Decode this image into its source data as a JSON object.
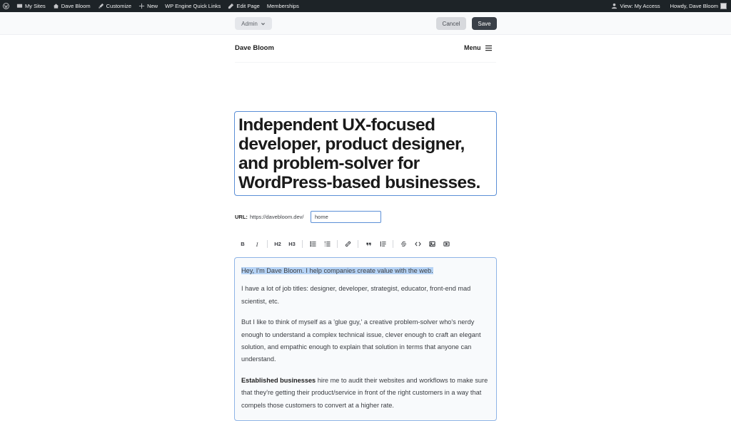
{
  "adminbar": {
    "left": [
      {
        "label": "",
        "icon": "wordpress-logo-icon"
      },
      {
        "label": "My Sites",
        "icon": "my-sites-icon"
      },
      {
        "label": "Dave Bloom",
        "icon": "home-dashboard-icon"
      },
      {
        "label": "Customize",
        "icon": "brush-icon"
      },
      {
        "label": "New",
        "icon": "plus-icon"
      },
      {
        "label": "WP Engine Quick Links",
        "icon": ""
      },
      {
        "label": "Edit Page",
        "icon": "pencil-icon"
      },
      {
        "label": "Memberships",
        "icon": ""
      }
    ],
    "view_access": "View: My Access",
    "howdy": "Howdy, Dave Bloom"
  },
  "toolbar": {
    "admin_label": "Admin",
    "cancel_label": "Cancel",
    "save_label": "Save"
  },
  "site": {
    "title": "Dave Bloom",
    "menu_label": "Menu"
  },
  "headline": "Independent UX-focused developer, product designer, and problem-solver for WordPress-based businesses.",
  "url": {
    "label": "URL:",
    "prefix": "https://davebloom.dev/",
    "slug": "home"
  },
  "format_toolbar": {
    "bold": "B",
    "italic": "I",
    "h2": "H2",
    "h3": "H3"
  },
  "body": {
    "p1": "Hey, I'm Dave Bloom. I help companies create value with the web.",
    "p2": "I have a lot of job titles: designer, developer, strategist, educator, front-end mad scientist, etc.",
    "p3": "But I like to think of myself as a 'glue guy,' a creative problem-solver who's nerdy enough to understand a complex technical issue, clever enough to craft an elegant solution, and empathic enough to explain that solution in terms that anyone can understand.",
    "p4_bold": "Established businesses",
    "p4_rest": " hire me to audit their websites and workflows to make sure that they're getting their product/service in front of the right customers in a way that compels those customers to convert at a higher rate."
  },
  "colors": {
    "adminbar_bg": "#1d2327",
    "focus_blue": "#5b8fd6",
    "selection": "#b6d3f5",
    "save_bg": "#3a4048"
  }
}
